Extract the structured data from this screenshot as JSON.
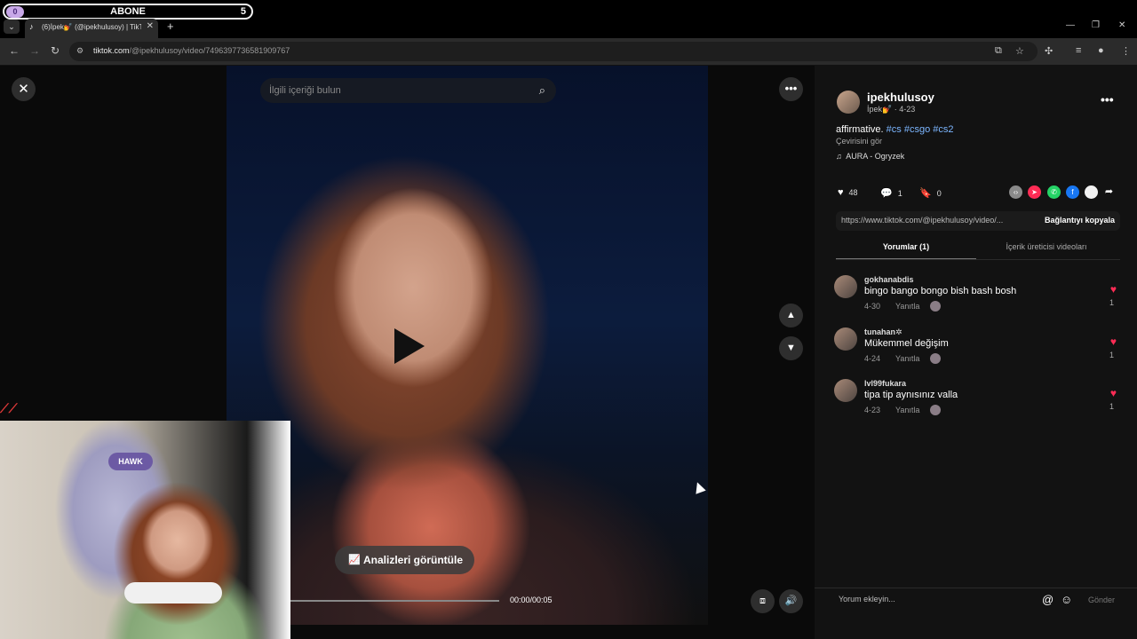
{
  "overlay": {
    "subscribe_label": "ABONE",
    "subscribe_count": "5",
    "left_count": "0"
  },
  "browser": {
    "tab_title": "(6)İpek💅 (@ipekhulusoy) | TikTok",
    "url_host": "tiktok.com",
    "url_path": "/@ipekhulusoy/video/7496397736581909767"
  },
  "video": {
    "search_placeholder": "İlgili içeriği bulun",
    "analytics_label": "Analizleri görüntüle",
    "time": "00:00/00:05",
    "progress": 0.0
  },
  "webcam": {
    "chair_brand": "HAWK"
  },
  "post": {
    "username": "ipekhulusoy",
    "display_name": "İpek💅",
    "date": "4-23",
    "caption": "affirmative.",
    "hashtags": [
      "#cs",
      "#csgo",
      "#cs2"
    ],
    "translate": "Çevirisini gör",
    "music": "AURA - Ogryzek",
    "likes": "48",
    "comments": "1",
    "saves": "0",
    "link": "https://www.tiktok.com/@ipekhulusoy/video/...",
    "copy_link": "Bağlantıyı kopyala"
  },
  "tabs": {
    "comments": "Yorumlar (1)",
    "creator_videos": "İçerik üreticisi videoları"
  },
  "comments": [
    {
      "user": "gokhanabdis",
      "text": "bingo bango bongo bish bash bosh",
      "date": "4-30",
      "reply": "Yanıtla",
      "likes": "1"
    },
    {
      "user": "tunahan✲",
      "text": "Mükemmel değişim",
      "date": "4-24",
      "reply": "Yanıtla",
      "likes": "1"
    },
    {
      "user": "lvl99fukara",
      "text": "tipa tip aynısınız valla",
      "date": "4-23",
      "reply": "Yanıtla",
      "likes": "1"
    }
  ],
  "composer": {
    "placeholder": "Yorum ekleyin...",
    "send": "Gönder"
  },
  "colors": {
    "accent_pink": "#fe2c55",
    "hashtag": "#7cb6ff"
  }
}
